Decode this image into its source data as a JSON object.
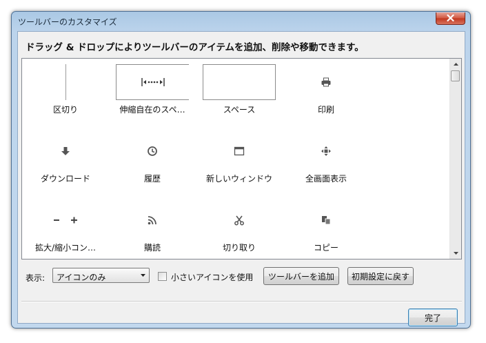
{
  "window": {
    "title": "ツールバーのカスタマイズ"
  },
  "instruction": "ドラッグ & ドロップによりツールバーのアイテムを追加、削除や移動できます。",
  "palette": {
    "items": [
      {
        "label": "区切り",
        "icon": "separator"
      },
      {
        "label": "伸縮自在のスペ…",
        "icon": "flexible-space"
      },
      {
        "label": "スペース",
        "icon": "space"
      },
      {
        "label": "印刷",
        "icon": "printer-icon"
      },
      {
        "label": "ダウンロード",
        "icon": "download-icon"
      },
      {
        "label": "履歴",
        "icon": "history-icon"
      },
      {
        "label": "新しいウィンドウ",
        "icon": "new-window-icon"
      },
      {
        "label": "全画面表示",
        "icon": "fullscreen-icon"
      },
      {
        "label": "拡大/縮小コン…",
        "icon": "zoom-controls-icon"
      },
      {
        "label": "購読",
        "icon": "feed-icon"
      },
      {
        "label": "切り取り",
        "icon": "cut-icon"
      },
      {
        "label": "コピー",
        "icon": "copy-icon"
      }
    ]
  },
  "controls": {
    "show_label": "表示:",
    "show_select": {
      "value": "アイコンのみ"
    },
    "small_icons": {
      "label": "小さいアイコンを使用",
      "checked": false
    },
    "add_toolbar_label": "ツールバーを追加",
    "restore_default_label": "初期設定に戻す"
  },
  "footer": {
    "done_label": "完了"
  },
  "colors": {
    "title_bar": "#bcd4ec",
    "close_button": "#c1381f",
    "dialog_bg": "#f0f0f0",
    "palette_bg": "#ffffff",
    "icon_gray": "#555555",
    "done_focus_border": "#3c7fb1"
  }
}
